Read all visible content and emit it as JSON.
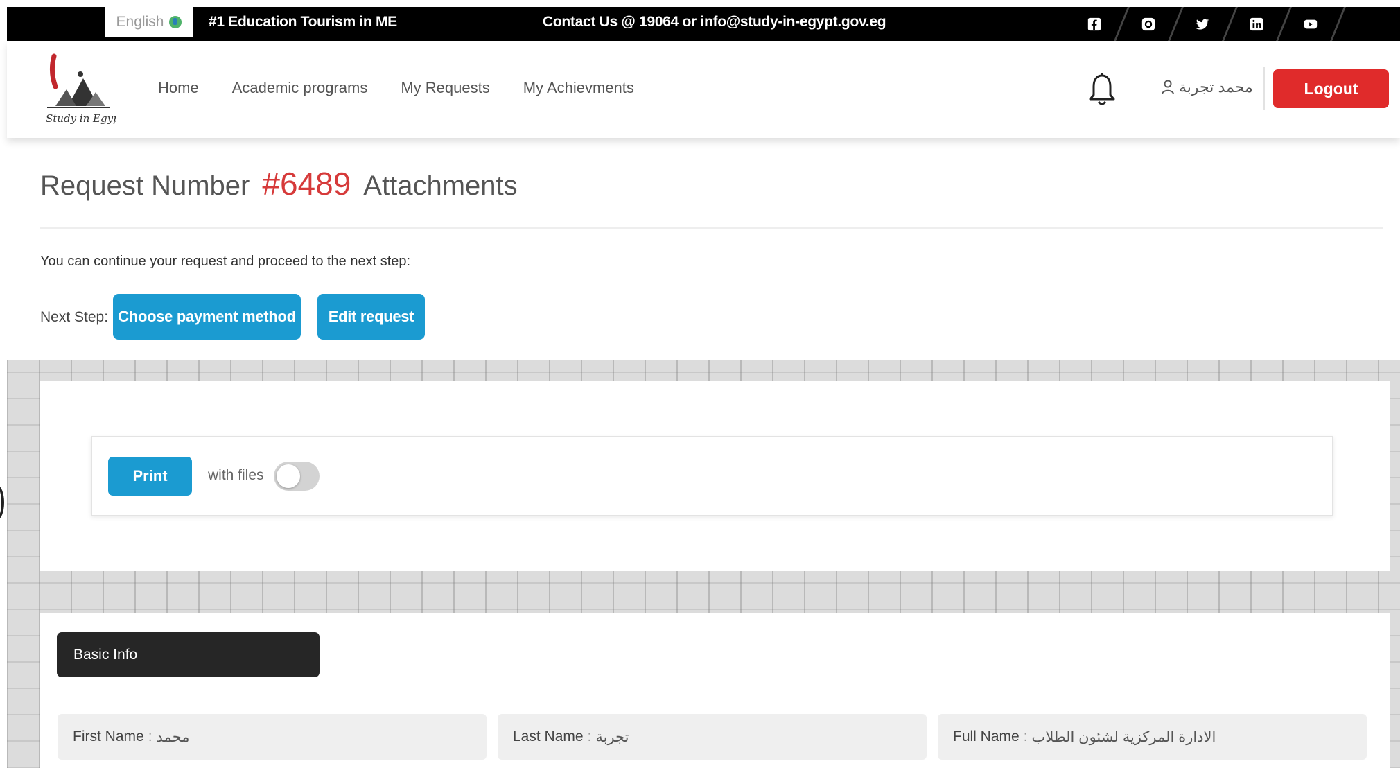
{
  "topbar": {
    "language": "English",
    "tagline": "#1 Education Tourism in ME",
    "contact": "Contact Us @ 19064 or info@study-in-egypt.gov.eg",
    "social_icons": [
      "facebook-icon",
      "instagram-icon",
      "twitter-icon",
      "linkedin-icon",
      "youtube-icon"
    ]
  },
  "header": {
    "logo_text": "Study in Egypt",
    "nav": [
      "Home",
      "Academic programs",
      "My Requests",
      "My Achievments"
    ],
    "user_name": "محمد تجربة",
    "logout_label": "Logout"
  },
  "page": {
    "title_prefix": "Request Number",
    "request_number": "#6489",
    "title_suffix": "Attachments",
    "continue_text": "You can continue your request and proceed to the next step:",
    "next_step_label": "Next Step:",
    "choose_payment_label": "Choose payment method",
    "edit_request_label": "Edit request"
  },
  "print_section": {
    "print_label": "Print",
    "with_files_label": "with files",
    "with_files_enabled": false
  },
  "basic_info": {
    "heading": "Basic Info",
    "fields": [
      {
        "label": "First Name",
        "value": "محمد"
      },
      {
        "label": "Last Name",
        "value": "تجربة"
      },
      {
        "label": "Full Name",
        "value": "الادارة المركزية لشئون الطلاب"
      }
    ]
  },
  "colors": {
    "primary_blue": "#1b9bd1",
    "logout_red": "#e02b2b",
    "request_number_red": "#d63a3a",
    "topbar_black": "#000000",
    "basic_info_dark": "#262626"
  }
}
